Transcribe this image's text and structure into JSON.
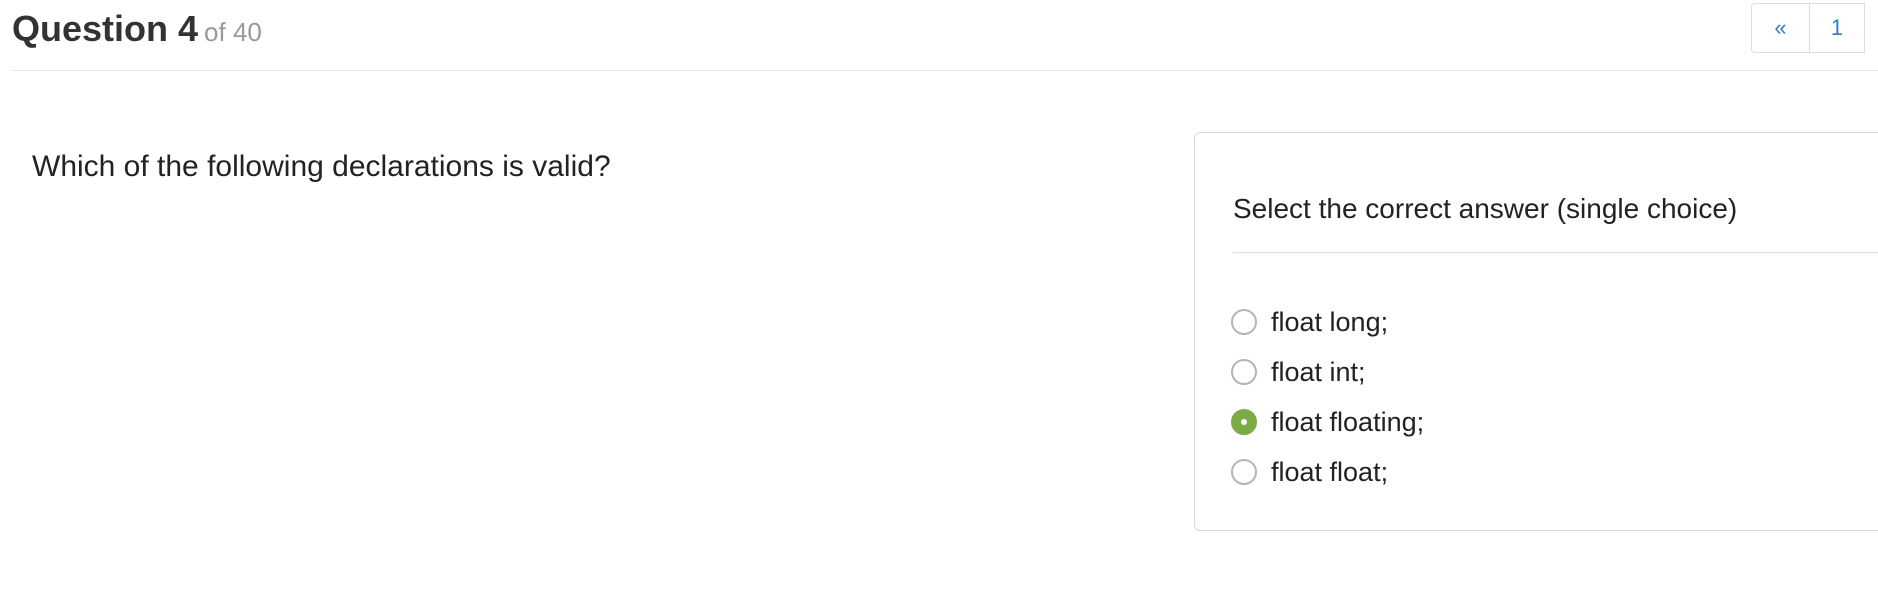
{
  "header": {
    "title": "Question 4",
    "of_text": "of 40"
  },
  "pagination": {
    "prev_label": "«",
    "pages": [
      "1"
    ]
  },
  "question": {
    "text": "Which of the following declarations is valid?"
  },
  "answer_panel": {
    "heading": "Select the correct answer (single choice)",
    "options": [
      {
        "label": "float long;",
        "selected": false
      },
      {
        "label": "float int;",
        "selected": false
      },
      {
        "label": "float floating;",
        "selected": true
      },
      {
        "label": "float float;",
        "selected": false
      }
    ]
  },
  "colors": {
    "accent_selected": "#7aab47",
    "link": "#2a7fc1"
  }
}
